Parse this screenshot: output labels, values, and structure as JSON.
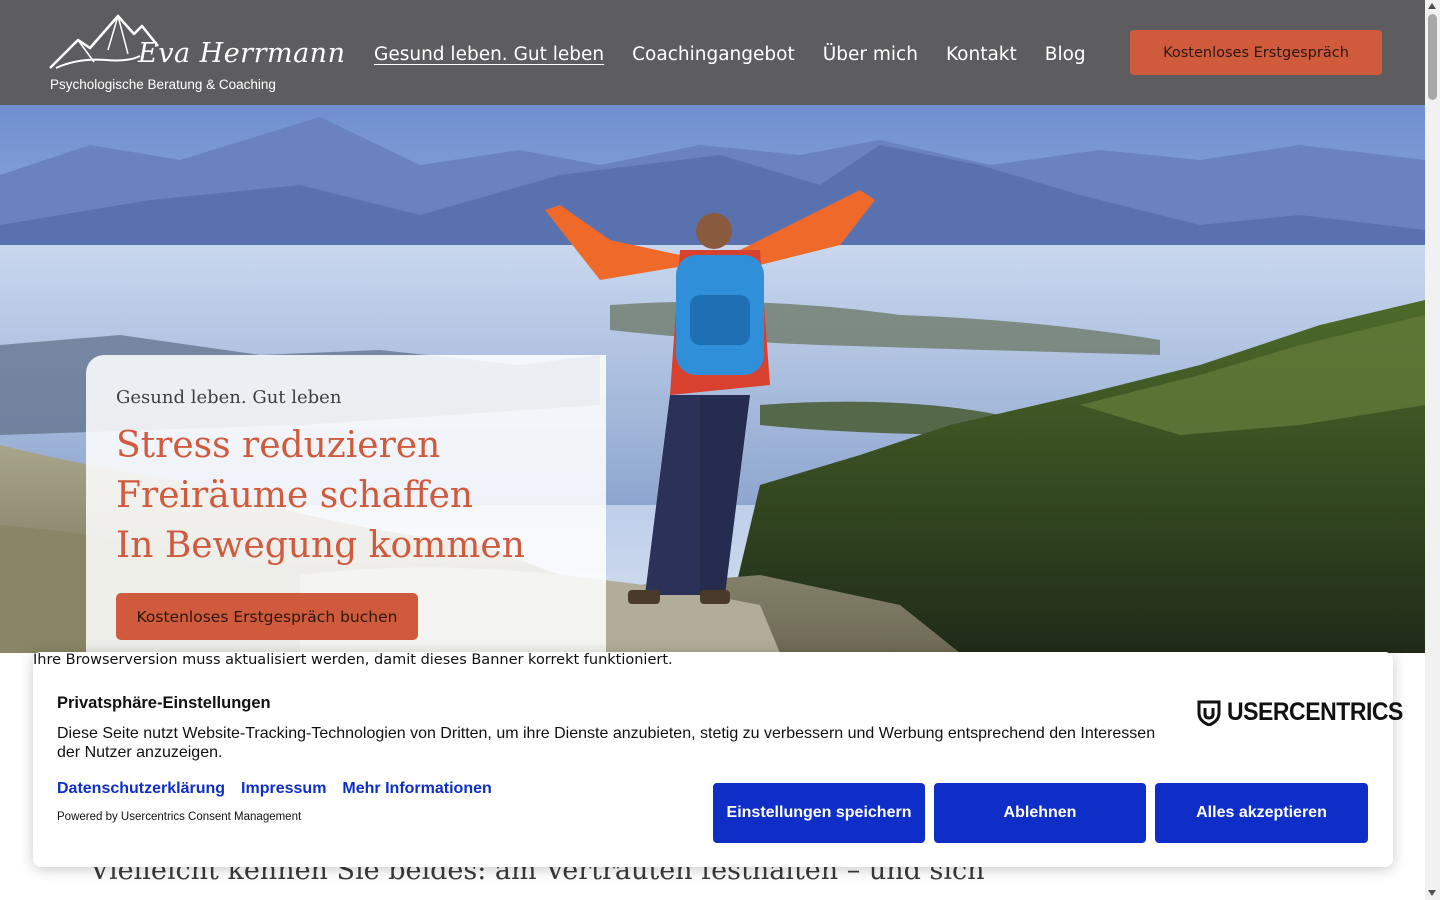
{
  "header": {
    "logo": {
      "name": "Eva Herrmann",
      "tagline": "Psychologische Beratung & Coaching"
    },
    "nav": [
      {
        "label": "Gesund leben. Gut leben",
        "active": true
      },
      {
        "label": "Coachingangebot",
        "active": false
      },
      {
        "label": "Über mich",
        "active": false
      },
      {
        "label": "Kontakt",
        "active": false
      },
      {
        "label": "Blog",
        "active": false
      }
    ],
    "cta_label": "Kostenloses Erstgespräch"
  },
  "hero": {
    "eyebrow": "Gesund leben. Gut leben",
    "lines": [
      "Stress reduzieren",
      "Freiräume schaffen",
      "In Bewegung kommen"
    ],
    "cta_label": "Kostenloses Erstgespräch buchen"
  },
  "page_text_partial": "Vielleicht kennen Sie beides: am Vertrauten festhalten – und sich",
  "browser_notice": "Ihre Browserversion muss aktualisiert werden, damit dieses Banner korrekt funktioniert.",
  "consent": {
    "title": "Privatsphäre-Einstellungen",
    "description": "Diese Seite nutzt Website-Tracking-Technologien von Dritten, um ihre Dienste anzubieten, stetig zu verbessern und Werbung entsprechend den Interessen der Nutzer anzuzeigen.",
    "links": [
      "Datenschutzerklärung",
      "Impressum",
      "Mehr Informationen"
    ],
    "powered_by": "Powered by Usercentrics Consent Management",
    "brand_logo": "USERCENTRICS",
    "buttons": {
      "settings": "Einstellungen speichern",
      "deny": "Ablehnen",
      "accept": "Alles akzeptieren"
    }
  },
  "colors": {
    "header_bg": "#5d5d5f",
    "accent": "#d05a3c",
    "consent_button": "#0e2ec7",
    "consent_link": "#0e2ec7"
  },
  "icons": [
    "mountain-logo-icon",
    "usercentrics-shield-icon",
    "scroll-up-arrow-icon",
    "scroll-down-arrow-icon"
  ]
}
